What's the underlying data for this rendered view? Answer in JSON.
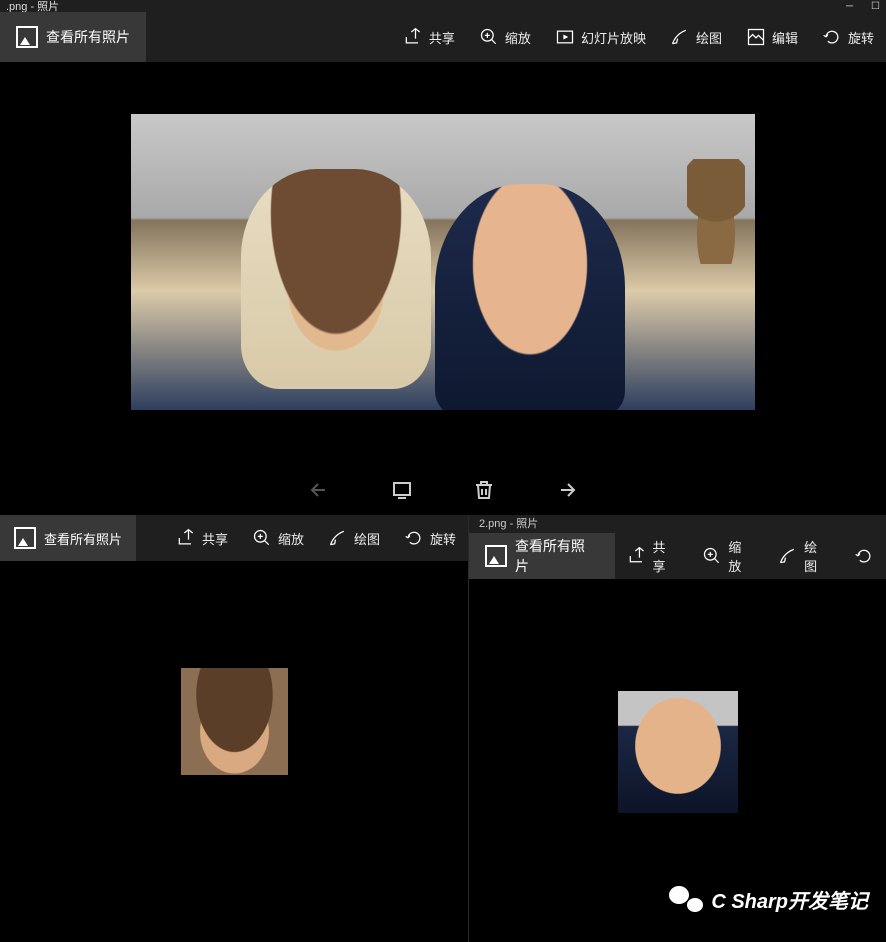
{
  "top": {
    "title": ".png - 照片",
    "view_all": "查看所有照片",
    "toolbar": {
      "share": "共享",
      "zoom": "缩放",
      "slideshow": "幻灯片放映",
      "draw": "绘图",
      "edit": "编辑",
      "rotate": "旋转"
    }
  },
  "bl": {
    "view_all": "查看所有照片",
    "toolbar": {
      "share": "共享",
      "zoom": "缩放",
      "draw": "绘图",
      "rotate": "旋转"
    }
  },
  "br": {
    "title": "2.png - 照片",
    "view_all": "查看所有照片",
    "toolbar": {
      "share": "共享",
      "zoom": "缩放",
      "draw": "绘图"
    }
  },
  "watermark": "C Sharp开发笔记"
}
